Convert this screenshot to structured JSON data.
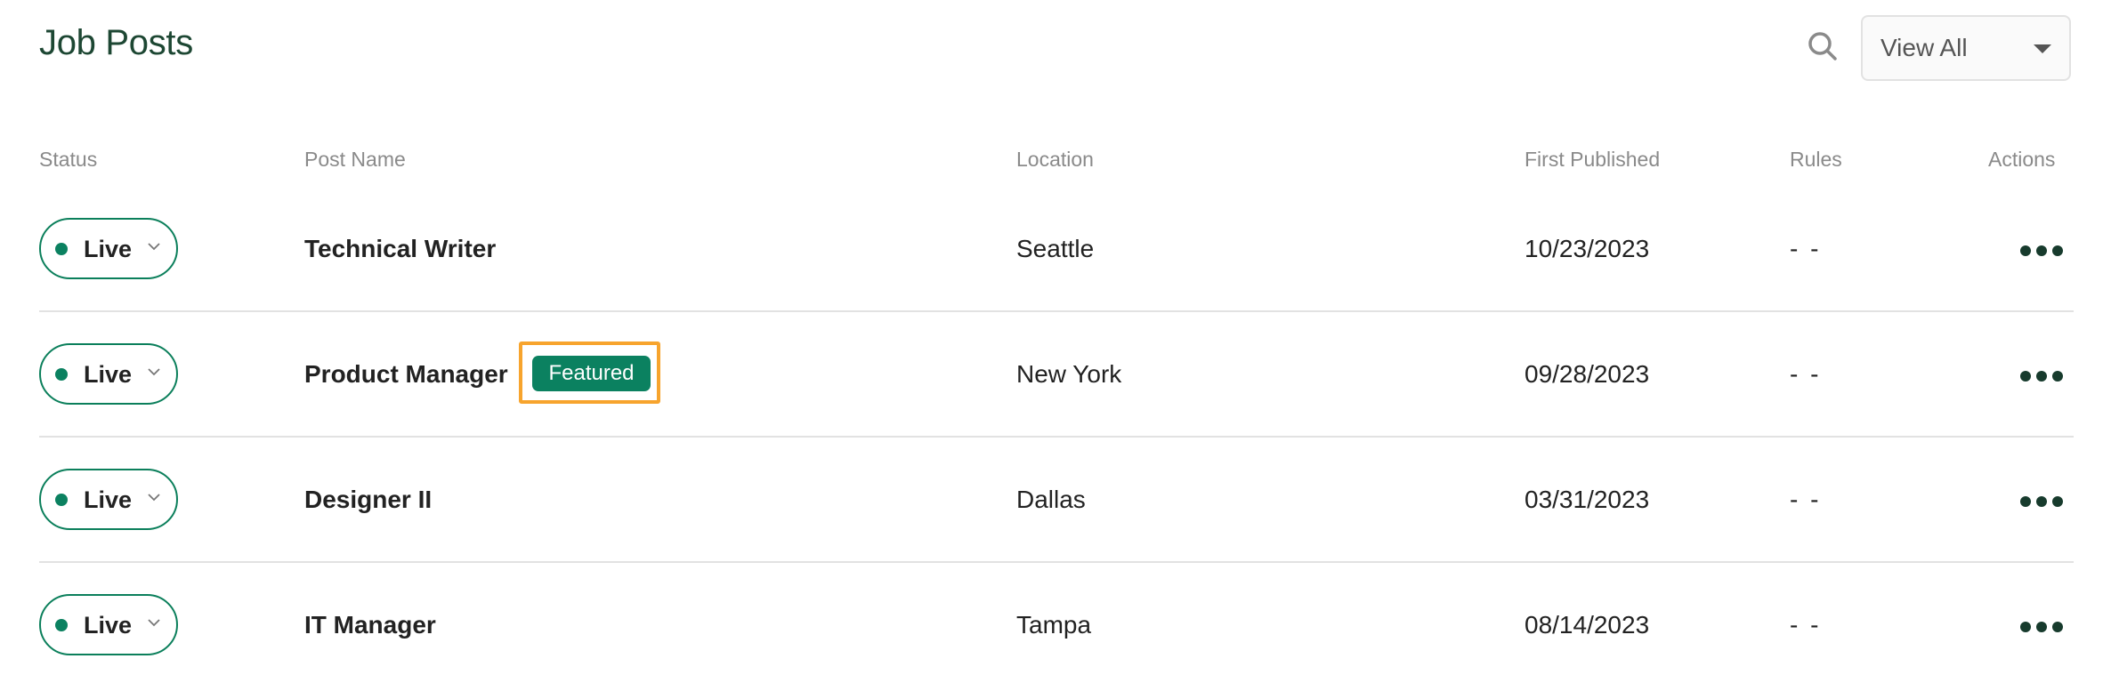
{
  "page": {
    "title": "Job Posts"
  },
  "toolbar": {
    "search_icon": "search-icon",
    "filter": {
      "selected": "View All",
      "caret_icon": "caret-down-icon"
    }
  },
  "table": {
    "headers": {
      "status": "Status",
      "post_name": "Post Name",
      "location": "Location",
      "first_published": "First Published",
      "rules": "Rules",
      "actions": "Actions"
    },
    "rows": [
      {
        "status": "Live",
        "post_name": "Technical Writer",
        "badge": null,
        "location": "Seattle",
        "first_published": "10/23/2023",
        "rules": "- -"
      },
      {
        "status": "Live",
        "post_name": "Product Manager",
        "badge": "Featured",
        "location": "New York",
        "first_published": "09/28/2023",
        "rules": "- -"
      },
      {
        "status": "Live",
        "post_name": "Designer II",
        "badge": null,
        "location": "Dallas",
        "first_published": "03/31/2023",
        "rules": "- -"
      },
      {
        "status": "Live",
        "post_name": "IT Manager",
        "badge": null,
        "location": "Tampa",
        "first_published": "08/14/2023",
        "rules": "- -"
      }
    ]
  },
  "colors": {
    "brand_green": "#0b8160",
    "title_green": "#1d4733",
    "highlight_orange": "#f7a42d",
    "actions_dots": "#173b2d"
  }
}
